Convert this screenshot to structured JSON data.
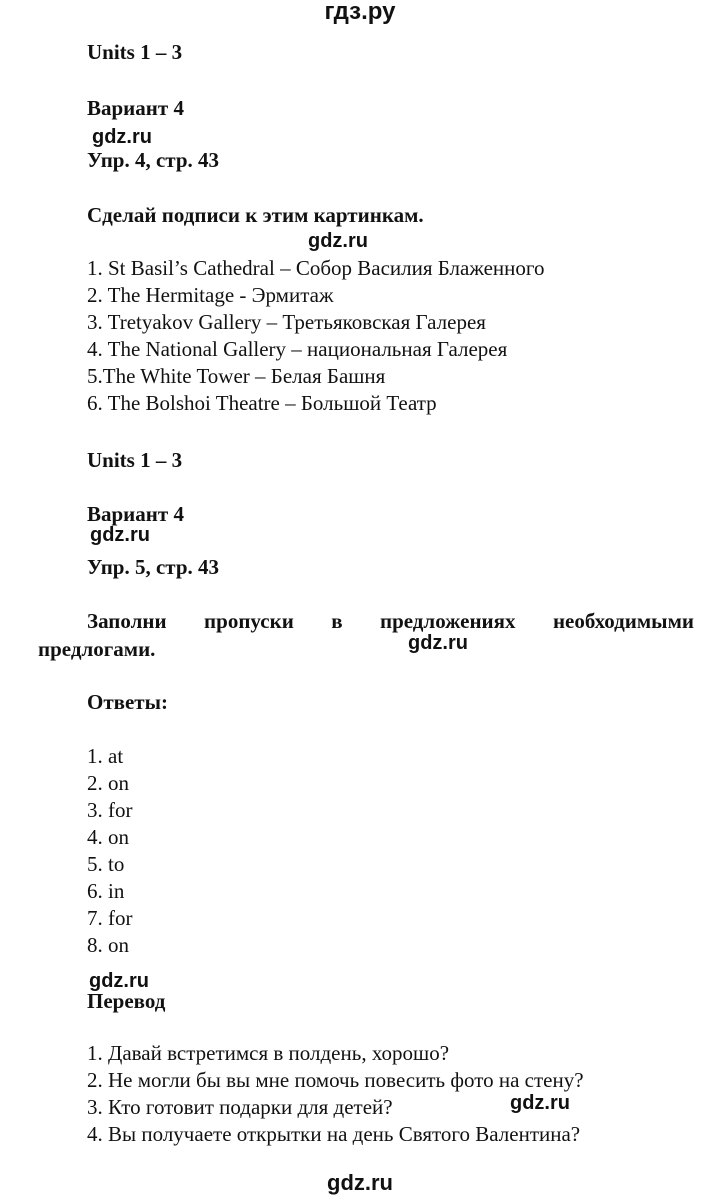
{
  "header": {
    "site": "гдз.ру"
  },
  "watermark": "gdz.ru",
  "section1": {
    "units": "Units 1 – 3",
    "variant": "Вариант 4",
    "exercise": "Упр. 4, стр. 43",
    "task": "Сделай подписи к этим картинкам.",
    "items": [
      "1. St Basil’s Cathedral – Собор Василия Блаженного",
      "2. The Hermitage - Эрмитаж",
      "3. Tretyakov Gallery – Третьяковская Галерея",
      "4. The National Gallery – национальная Галерея",
      "5.The White Tower – Белая Башня",
      "6. The Bolshoi Theatre – Большой Театр"
    ]
  },
  "section2": {
    "units": "Units 1 – 3",
    "variant": "Вариант 4",
    "exercise": "Упр. 5, стр. 43",
    "task_line1": "Заполни пропуски в предложениях необходимыми",
    "task_line2": "предлогами.",
    "answers_heading": "Ответы:",
    "answers": [
      "1. at",
      "2. on",
      "3. for",
      "4. on",
      "5. to",
      "6. in",
      "7. for",
      "8. on"
    ],
    "translation_heading": "Перевод",
    "translations": [
      "1. Давай встретимся в полдень, хорошо?",
      "2. Не могли бы вы мне помочь повесить фото на стену?",
      "3. Кто готовит подарки для детей?",
      "4. Вы получаете открытки на день Святого Валентина?"
    ]
  }
}
